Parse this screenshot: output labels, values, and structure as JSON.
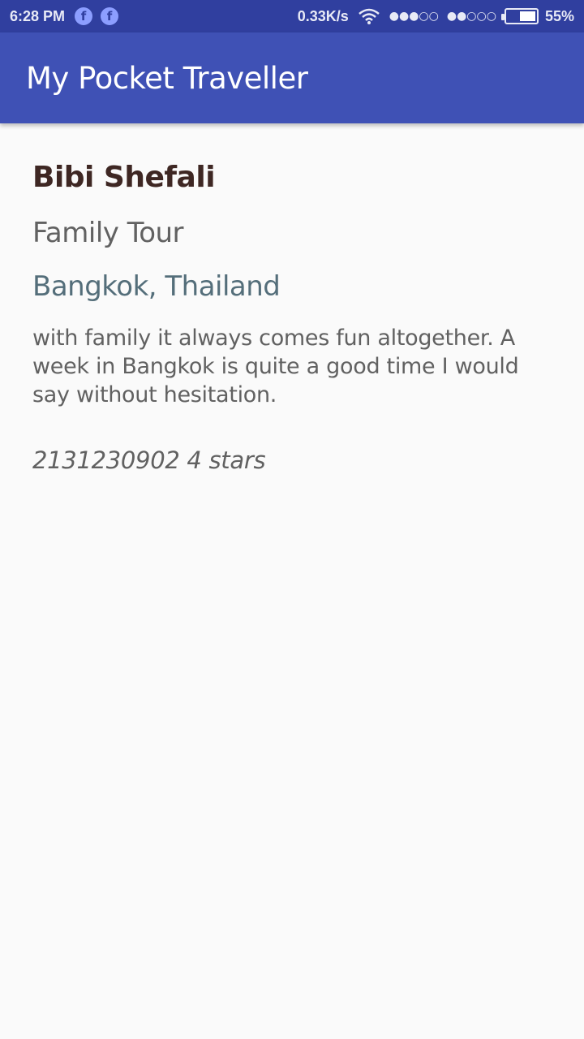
{
  "status_bar": {
    "time": "6:28 PM",
    "notification_icons": [
      "facebook-icon",
      "facebook-icon"
    ],
    "fb_glyph": "f",
    "net_speed": "0.33K/s",
    "signal1": "●●●○○",
    "signal2": "●●○○○",
    "battery_level": 0.55,
    "battery_text": "55%"
  },
  "app_bar": {
    "title": "My Pocket Traveller",
    "color": "#3f51b5"
  },
  "entry": {
    "name": "Bibi Shefali",
    "tour_type": "Family Tour",
    "location": "Bangkok, Thailand",
    "description": "with family it always comes fun altogether. A week in Bangkok is quite a good time I would say without hesitation.",
    "meta": "2131230902 4 stars"
  },
  "colors": {
    "status_bar": "#303f9f",
    "background": "#fafafa",
    "name": "#3e2723",
    "location": "#546e7a"
  }
}
